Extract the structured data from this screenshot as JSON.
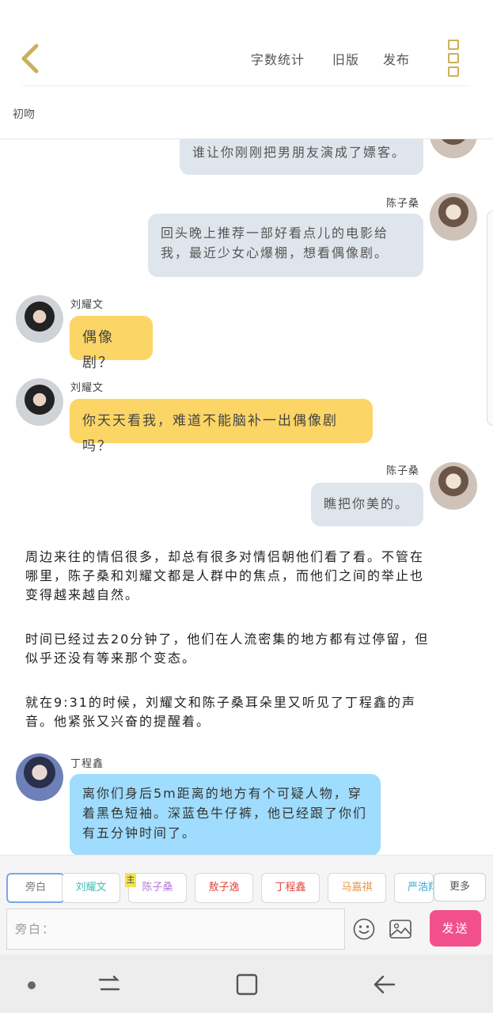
{
  "header": {
    "actions": {
      "word_count": "字数统计",
      "old_version": "旧版",
      "publish": "发布"
    },
    "draft_label": "初吻"
  },
  "chat": {
    "messages": [
      {
        "speaker": "",
        "text": "谁让你刚刚把男朋友演成了嫖客。"
      },
      {
        "speaker": "陈子桑",
        "text": "回头晚上推荐一部好看点儿的电影给我，最近少女心爆棚，想看偶像剧。"
      },
      {
        "speaker": "刘耀文",
        "text": "偶像剧？"
      },
      {
        "speaker": "刘耀文",
        "text": "你天天看我，难道不能脑补一出偶像剧吗？"
      },
      {
        "speaker": "陈子桑",
        "text": "瞧把你美的。"
      }
    ],
    "narration": [
      "周边来往的情侣很多，却总有很多对情侣朝他们看了看。不管在哪里，陈子桑和刘耀文都是人群中的焦点，而他们之间的举止也变得越来越自然。",
      "时间已经过去20分钟了，他们在人流密集的地方都有过停留，但似乎还没有等来那个变态。",
      "就在9:31的时候，刘耀文和陈子桑耳朵里又听见了丁程鑫的声音。他紧张又兴奋的提醒着。"
    ],
    "last_message": {
      "speaker": "丁程鑫",
      "text": "离你们身后5m距离的地方有个可疑人物，穿着黑色短袖。深蓝色牛仔裤，他已经跟了你们有五分钟时间了。"
    }
  },
  "roles": [
    {
      "label": "旁白",
      "color": "#7a7a7a"
    },
    {
      "label": "刘耀文",
      "color": "#3cc0b6"
    },
    {
      "label": "陈子桑",
      "color": "#b678d8"
    },
    {
      "label": "敖子逸",
      "color": "#e0483c"
    },
    {
      "label": "丁程鑫",
      "color": "#e0483c"
    },
    {
      "label": "马嘉祺",
      "color": "#e8964a"
    },
    {
      "label": "严浩翔",
      "color": "#3aa7d8"
    }
  ],
  "main_badge": "主",
  "more_label": "更多",
  "input": {
    "placeholder": "旁白："
  },
  "send_label": "发送",
  "colors": {
    "accent": "#f2508c",
    "gold": "#c9b15a",
    "yellow_bubble": "#fbd566",
    "grey_bubble": "#dfe5ec",
    "blue_bubble": "#9fdcfd"
  }
}
